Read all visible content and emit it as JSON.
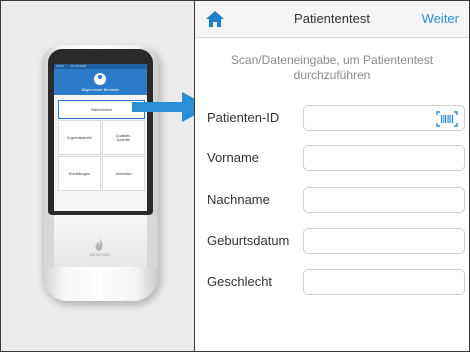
{
  "device": {
    "screen": {
      "status_time": "14:53",
      "status_date": "07.04.2015",
      "user_label": "Allgemeiner Benutzer",
      "tiles": [
        "Patiententest",
        "Ergebnistabelle",
        "Qualitäts-\ncontrolle",
        "Einstellungen",
        "Abmelden"
      ]
    },
    "brand": "luminexDx"
  },
  "app": {
    "nav": {
      "title": "Patiententest",
      "next_label": "Weiter"
    },
    "instruction": "Scan/Dateneingabe, um Patiententest durchzuführen",
    "fields": [
      {
        "label": "Patienten-ID",
        "value": ""
      },
      {
        "label": "Vorname",
        "value": ""
      },
      {
        "label": "Nachname",
        "value": ""
      },
      {
        "label": "Geburtsdatum",
        "value": ""
      },
      {
        "label": "Geschlecht",
        "value": ""
      }
    ]
  },
  "colors": {
    "accent": "#2c8fd6",
    "device_header": "#2c7bc8",
    "arrow": "#2a8fd4"
  },
  "icons": [
    "home-icon",
    "barcode-icon",
    "user-icon",
    "arrow-right-icon",
    "flame-logo-icon"
  ]
}
